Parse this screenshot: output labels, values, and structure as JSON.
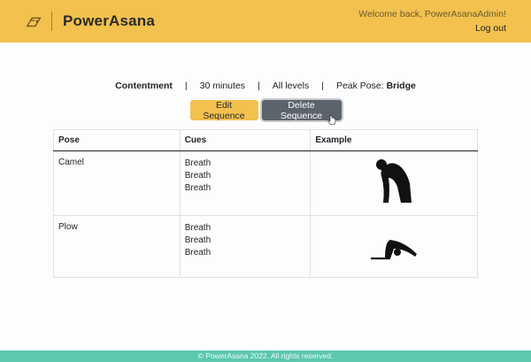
{
  "navbar": {
    "brand": "PowerAsana",
    "logo_icon": "yoga-mat-icon",
    "welcome": "Welcome back, PowerAsanaAdmin!",
    "logout": "Log out",
    "bg_color": "#f2c14e"
  },
  "sequence": {
    "title": "Contentment",
    "duration": "30 minutes",
    "level": "All levels",
    "peak_label": "Peak Pose:",
    "peak_value": "Bridge",
    "separator": "|"
  },
  "actions": {
    "edit_label": "Edit Sequence",
    "delete_label": "Delete Sequence"
  },
  "table": {
    "headers": [
      "Pose",
      "Cues",
      "Example"
    ],
    "rows": [
      {
        "pose": "Camel",
        "cues": [
          "Breath",
          "Breath",
          "Breath"
        ],
        "example_icon": "camel-pose-icon"
      },
      {
        "pose": "Plow",
        "cues": [
          "Breath",
          "Breath",
          "Breath"
        ],
        "example_icon": "plow-pose-icon"
      }
    ]
  },
  "footer": {
    "text": "© PowerAsana 2022. All rights reserved.",
    "bg_color": "#5cc8ae"
  }
}
